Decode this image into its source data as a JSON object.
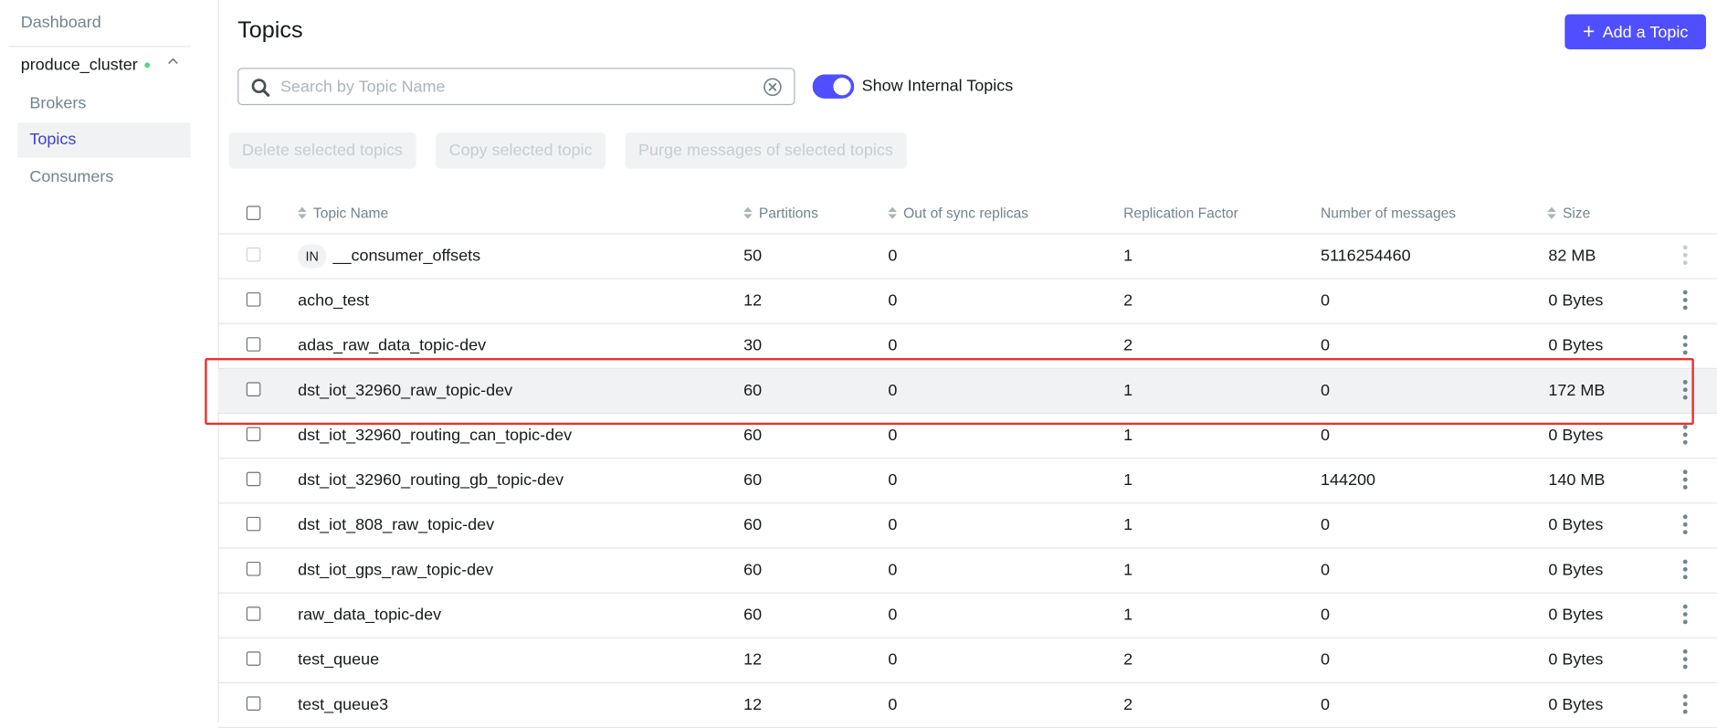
{
  "sidebar": {
    "dashboard": "Dashboard",
    "cluster_name": "produce_cluster",
    "cluster_status_color": "#5cd685",
    "items": [
      {
        "label": "Brokers"
      },
      {
        "label": "Topics"
      },
      {
        "label": "Consumers"
      }
    ],
    "active_item": "Topics"
  },
  "header": {
    "title": "Topics",
    "add_button_label": "Add a Topic"
  },
  "search": {
    "placeholder": "Search by Topic Name",
    "value": ""
  },
  "toggle": {
    "label": "Show Internal Topics",
    "checked": true
  },
  "bulk_actions": [
    {
      "label": "Delete selected topics"
    },
    {
      "label": "Copy selected topic"
    },
    {
      "label": "Purge messages of selected topics"
    }
  ],
  "table": {
    "columns": [
      "Topic Name",
      "Partitions",
      "Out of sync replicas",
      "Replication Factor",
      "Number of messages",
      "Size"
    ],
    "rows": [
      {
        "badge": "IN",
        "name": "__consumer_offsets",
        "partitions": "50",
        "out_of_sync": "0",
        "replication": "1",
        "messages": "5116254460",
        "size": "82 MB",
        "internal": true
      },
      {
        "badge": "",
        "name": "acho_test",
        "partitions": "12",
        "out_of_sync": "0",
        "replication": "2",
        "messages": "0",
        "size": "0 Bytes"
      },
      {
        "badge": "",
        "name": "adas_raw_data_topic-dev",
        "partitions": "30",
        "out_of_sync": "0",
        "replication": "2",
        "messages": "0",
        "size": "0 Bytes"
      },
      {
        "badge": "",
        "name": "dst_iot_32960_raw_topic-dev",
        "partitions": "60",
        "out_of_sync": "0",
        "replication": "1",
        "messages": "0",
        "size": "172 MB",
        "highlighted": true
      },
      {
        "badge": "",
        "name": "dst_iot_32960_routing_can_topic-dev",
        "partitions": "60",
        "out_of_sync": "0",
        "replication": "1",
        "messages": "0",
        "size": "0 Bytes"
      },
      {
        "badge": "",
        "name": "dst_iot_32960_routing_gb_topic-dev",
        "partitions": "60",
        "out_of_sync": "0",
        "replication": "1",
        "messages": "144200",
        "size": "140 MB"
      },
      {
        "badge": "",
        "name": "dst_iot_808_raw_topic-dev",
        "partitions": "60",
        "out_of_sync": "0",
        "replication": "1",
        "messages": "0",
        "size": "0 Bytes"
      },
      {
        "badge": "",
        "name": "dst_iot_gps_raw_topic-dev",
        "partitions": "60",
        "out_of_sync": "0",
        "replication": "1",
        "messages": "0",
        "size": "0 Bytes"
      },
      {
        "badge": "",
        "name": "raw_data_topic-dev",
        "partitions": "60",
        "out_of_sync": "0",
        "replication": "1",
        "messages": "0",
        "size": "0 Bytes"
      },
      {
        "badge": "",
        "name": "test_queue",
        "partitions": "12",
        "out_of_sync": "0",
        "replication": "2",
        "messages": "0",
        "size": "0 Bytes"
      },
      {
        "badge": "",
        "name": "test_queue3",
        "partitions": "12",
        "out_of_sync": "0",
        "replication": "2",
        "messages": "0",
        "size": "0 Bytes"
      }
    ]
  },
  "colors": {
    "accent": "#4f4fff",
    "active_nav_text": "#3e41c9",
    "annotation_border": "#e8312f"
  }
}
